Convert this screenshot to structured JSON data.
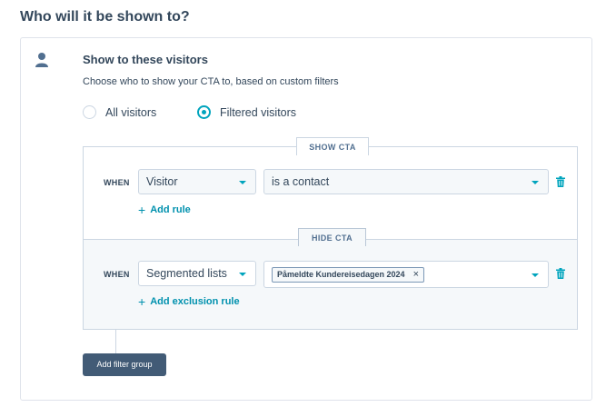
{
  "page": {
    "title": "Who will it be shown to?"
  },
  "section": {
    "icon": "person-icon",
    "title": "Show to these visitors",
    "description": "Choose who to show your CTA to, based on custom filters"
  },
  "visibility_options": [
    {
      "label": "All visitors",
      "checked": false
    },
    {
      "label": "Filtered visitors",
      "checked": true
    }
  ],
  "show_group": {
    "tag": "SHOW CTA",
    "when_label": "WHEN",
    "property_select": "Visitor",
    "condition_select": "is a contact",
    "add_rule_label": "Add rule"
  },
  "hide_group": {
    "tag": "HIDE CTA",
    "when_label": "WHEN",
    "property_select": "Segmented lists",
    "selected_list_chip": "Påmeldte Kundereisedagen 2024",
    "chip_remove": "×",
    "add_rule_label": "Add exclusion rule"
  },
  "actions": {
    "add_filter_group_label": "Add filter group"
  },
  "colors": {
    "accent": "#00a4bd",
    "link": "#0091ae",
    "text": "#33475b",
    "button": "#425b76",
    "border": "#cbd6e2"
  }
}
